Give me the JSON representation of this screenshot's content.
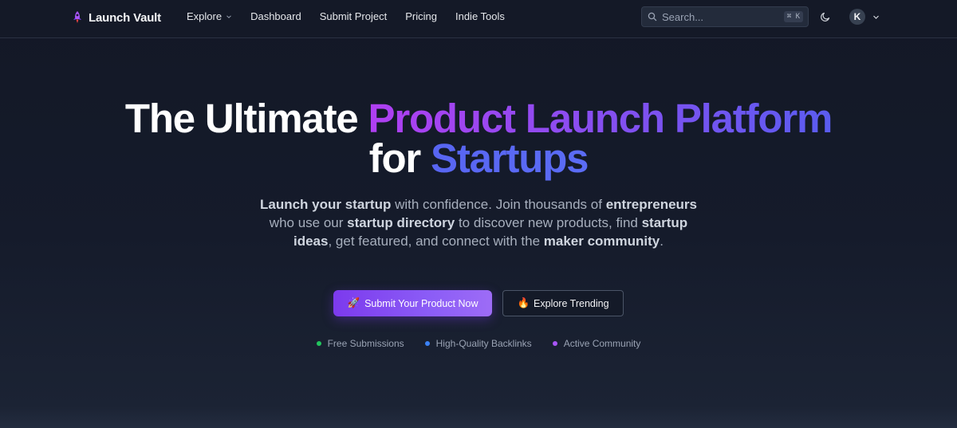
{
  "brand": {
    "name": "Launch Vault",
    "icon": "rocket-logo-icon"
  },
  "nav": {
    "items": [
      {
        "label": "Explore",
        "has_dropdown": true
      },
      {
        "label": "Dashboard"
      },
      {
        "label": "Submit Project"
      },
      {
        "label": "Pricing"
      },
      {
        "label": "Indie Tools"
      }
    ]
  },
  "search": {
    "placeholder": "Search...",
    "shortcut": "⌘ K",
    "icon": "search-icon"
  },
  "user": {
    "avatar_initial": "K"
  },
  "hero": {
    "title_part1": "The Ultimate ",
    "title_highlight": "Product Launch Platform",
    "title_part2": "for ",
    "title_highlight2": "Startups",
    "subtitle": [
      {
        "text": "Launch your startup",
        "bold": true
      },
      {
        "text": " with confidence. Join thousands of ",
        "bold": false
      },
      {
        "text": "entrepreneurs",
        "bold": true
      },
      {
        "text": " who use our ",
        "bold": false
      },
      {
        "text": "startup directory",
        "bold": true
      },
      {
        "text": " to discover new products, find ",
        "bold": false
      },
      {
        "text": "startup ideas",
        "bold": true
      },
      {
        "text": ", get featured, and connect with the ",
        "bold": false
      },
      {
        "text": "maker community",
        "bold": true
      },
      {
        "text": ".",
        "bold": false
      }
    ],
    "primary_cta": {
      "emoji": "🚀",
      "label": "Submit Your Product Now"
    },
    "secondary_cta": {
      "emoji": "🔥",
      "label": "Explore Trending"
    },
    "features": [
      {
        "label": "Free Submissions",
        "color": "#22c55e"
      },
      {
        "label": "High-Quality Backlinks",
        "color": "#3b82f6"
      },
      {
        "label": "Active Community",
        "color": "#a855f7"
      }
    ]
  },
  "colors": {
    "background": "#151b2b",
    "accent_purple": "#8b5cf6",
    "accent_blue": "#5865f2"
  }
}
